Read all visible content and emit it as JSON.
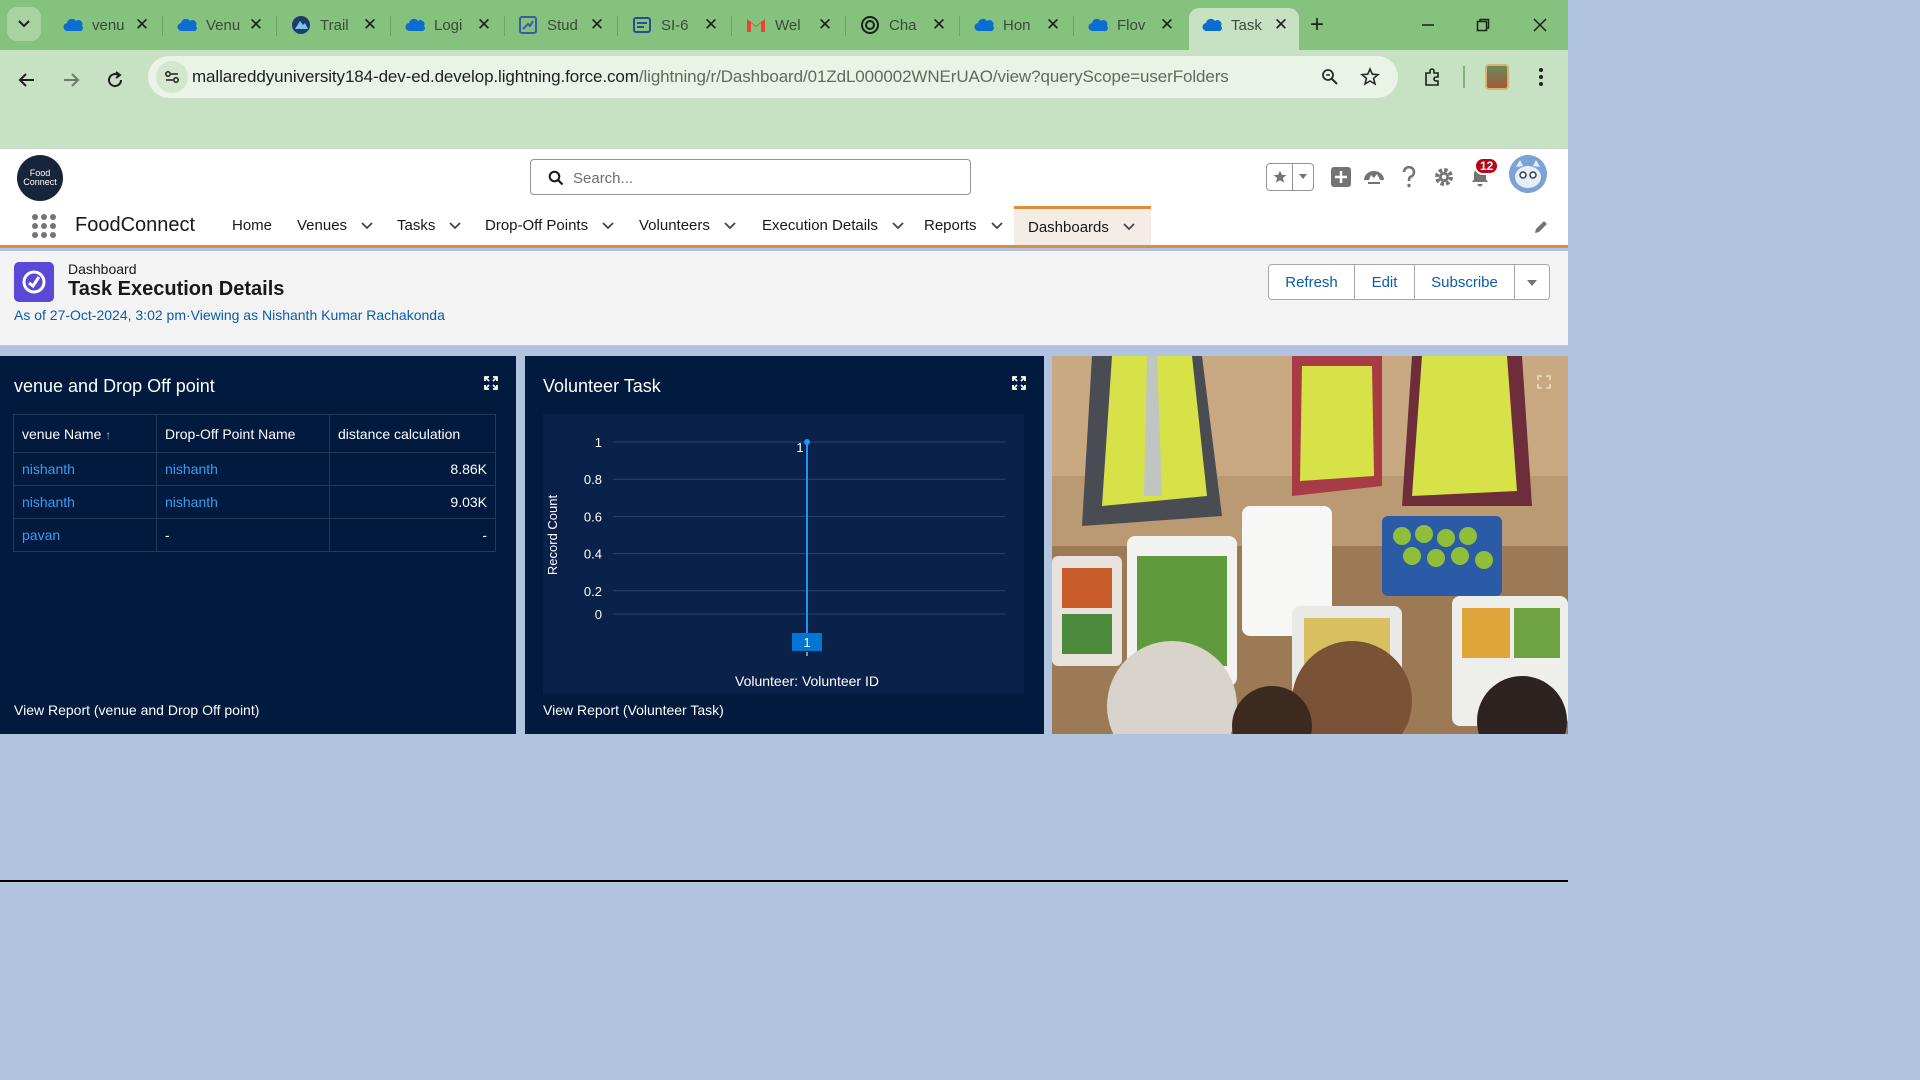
{
  "browser": {
    "tabs": [
      {
        "label": "venu",
        "icon": "salesforce-cloud-icon"
      },
      {
        "label": "Venu",
        "icon": "salesforce-cloud-icon"
      },
      {
        "label": "Trail",
        "icon": "trailhead-icon"
      },
      {
        "label": "Logi",
        "icon": "salesforce-cloud-icon"
      },
      {
        "label": "Stud",
        "icon": "studio-icon"
      },
      {
        "label": "SI-6",
        "icon": "document-icon"
      },
      {
        "label": "Wel",
        "icon": "gmail-icon"
      },
      {
        "label": "Cha",
        "icon": "chatgpt-icon"
      },
      {
        "label": "Hon",
        "icon": "salesforce-cloud-icon"
      },
      {
        "label": "Flov",
        "icon": "salesforce-cloud-icon"
      },
      {
        "label": "Task",
        "icon": "salesforce-cloud-icon",
        "active": true
      }
    ],
    "url_host": "mallareddyuniversity184-dev-ed.develop.lightning.force.com",
    "url_path": "/lightning/r/Dashboard/01ZdL000002WNErUAO/view?queryScope=userFolders"
  },
  "sf": {
    "logo_text": "Food Connect",
    "search_placeholder": "Search...",
    "notification_count": "12",
    "app_name": "FoodConnect",
    "nav": [
      {
        "label": "Home",
        "has_menu": false
      },
      {
        "label": "Venues",
        "has_menu": true
      },
      {
        "label": "Tasks",
        "has_menu": true
      },
      {
        "label": "Drop-Off Points",
        "has_menu": true
      },
      {
        "label": "Volunteers",
        "has_menu": true
      },
      {
        "label": "Execution Details",
        "has_menu": true
      },
      {
        "label": "Reports",
        "has_menu": true
      },
      {
        "label": "Dashboards",
        "has_menu": true,
        "active": true
      }
    ]
  },
  "page": {
    "object_type": "Dashboard",
    "title": "Task Execution Details",
    "subtitle": "As of 27-Oct-2024, 3:02 pm·Viewing as Nishanth Kumar Rachakonda",
    "buttons": {
      "refresh": "Refresh",
      "edit": "Edit",
      "subscribe": "Subscribe"
    }
  },
  "widgets": {
    "table": {
      "title": "venue and Drop Off point",
      "columns": [
        "venue Name",
        "Drop-Off Point Name",
        "distance calculation"
      ],
      "sort_indicator": "↑",
      "rows": [
        [
          "nishanth",
          "nishanth",
          "8.86K"
        ],
        [
          "nishanth",
          "nishanth",
          "9.03K"
        ],
        [
          "pavan",
          "-",
          "-"
        ]
      ],
      "footer": "View Report (venue and Drop Off point)"
    },
    "chart": {
      "title": "Volunteer Task",
      "footer": "View Report (Volunteer Task)"
    }
  },
  "chart_data": {
    "type": "line",
    "title": "Volunteer Task",
    "xlabel": "Volunteer: Volunteer ID",
    "ylabel": "Record Count",
    "ylim": [
      0,
      1
    ],
    "yticks": [
      "1",
      "0.8",
      "0.6",
      "0.4",
      "0.2",
      "0"
    ],
    "categories": [
      "1"
    ],
    "series": [
      {
        "values": [
          1
        ]
      }
    ],
    "data_labels": [
      "1"
    ],
    "grid": true
  },
  "colors": {
    "tab_strip": "#84c27e",
    "toolbar": "#c7e2c2",
    "accent_orange": "#e08c3a",
    "widget_bg": "#011a3d",
    "link_blue": "#0b5cab",
    "chart_blue": "#0176d3"
  }
}
